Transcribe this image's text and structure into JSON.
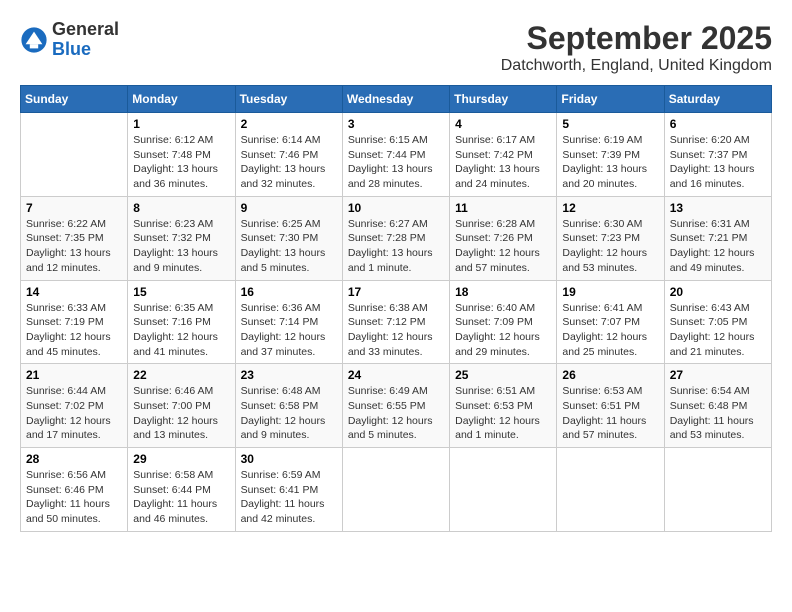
{
  "logo": {
    "general": "General",
    "blue": "Blue"
  },
  "title": "September 2025",
  "location": "Datchworth, England, United Kingdom",
  "headers": [
    "Sunday",
    "Monday",
    "Tuesday",
    "Wednesday",
    "Thursday",
    "Friday",
    "Saturday"
  ],
  "weeks": [
    [
      {
        "day": "",
        "info": ""
      },
      {
        "day": "1",
        "info": "Sunrise: 6:12 AM\nSunset: 7:48 PM\nDaylight: 13 hours\nand 36 minutes."
      },
      {
        "day": "2",
        "info": "Sunrise: 6:14 AM\nSunset: 7:46 PM\nDaylight: 13 hours\nand 32 minutes."
      },
      {
        "day": "3",
        "info": "Sunrise: 6:15 AM\nSunset: 7:44 PM\nDaylight: 13 hours\nand 28 minutes."
      },
      {
        "day": "4",
        "info": "Sunrise: 6:17 AM\nSunset: 7:42 PM\nDaylight: 13 hours\nand 24 minutes."
      },
      {
        "day": "5",
        "info": "Sunrise: 6:19 AM\nSunset: 7:39 PM\nDaylight: 13 hours\nand 20 minutes."
      },
      {
        "day": "6",
        "info": "Sunrise: 6:20 AM\nSunset: 7:37 PM\nDaylight: 13 hours\nand 16 minutes."
      }
    ],
    [
      {
        "day": "7",
        "info": "Sunrise: 6:22 AM\nSunset: 7:35 PM\nDaylight: 13 hours\nand 12 minutes."
      },
      {
        "day": "8",
        "info": "Sunrise: 6:23 AM\nSunset: 7:32 PM\nDaylight: 13 hours\nand 9 minutes."
      },
      {
        "day": "9",
        "info": "Sunrise: 6:25 AM\nSunset: 7:30 PM\nDaylight: 13 hours\nand 5 minutes."
      },
      {
        "day": "10",
        "info": "Sunrise: 6:27 AM\nSunset: 7:28 PM\nDaylight: 13 hours\nand 1 minute."
      },
      {
        "day": "11",
        "info": "Sunrise: 6:28 AM\nSunset: 7:26 PM\nDaylight: 12 hours\nand 57 minutes."
      },
      {
        "day": "12",
        "info": "Sunrise: 6:30 AM\nSunset: 7:23 PM\nDaylight: 12 hours\nand 53 minutes."
      },
      {
        "day": "13",
        "info": "Sunrise: 6:31 AM\nSunset: 7:21 PM\nDaylight: 12 hours\nand 49 minutes."
      }
    ],
    [
      {
        "day": "14",
        "info": "Sunrise: 6:33 AM\nSunset: 7:19 PM\nDaylight: 12 hours\nand 45 minutes."
      },
      {
        "day": "15",
        "info": "Sunrise: 6:35 AM\nSunset: 7:16 PM\nDaylight: 12 hours\nand 41 minutes."
      },
      {
        "day": "16",
        "info": "Sunrise: 6:36 AM\nSunset: 7:14 PM\nDaylight: 12 hours\nand 37 minutes."
      },
      {
        "day": "17",
        "info": "Sunrise: 6:38 AM\nSunset: 7:12 PM\nDaylight: 12 hours\nand 33 minutes."
      },
      {
        "day": "18",
        "info": "Sunrise: 6:40 AM\nSunset: 7:09 PM\nDaylight: 12 hours\nand 29 minutes."
      },
      {
        "day": "19",
        "info": "Sunrise: 6:41 AM\nSunset: 7:07 PM\nDaylight: 12 hours\nand 25 minutes."
      },
      {
        "day": "20",
        "info": "Sunrise: 6:43 AM\nSunset: 7:05 PM\nDaylight: 12 hours\nand 21 minutes."
      }
    ],
    [
      {
        "day": "21",
        "info": "Sunrise: 6:44 AM\nSunset: 7:02 PM\nDaylight: 12 hours\nand 17 minutes."
      },
      {
        "day": "22",
        "info": "Sunrise: 6:46 AM\nSunset: 7:00 PM\nDaylight: 12 hours\nand 13 minutes."
      },
      {
        "day": "23",
        "info": "Sunrise: 6:48 AM\nSunset: 6:58 PM\nDaylight: 12 hours\nand 9 minutes."
      },
      {
        "day": "24",
        "info": "Sunrise: 6:49 AM\nSunset: 6:55 PM\nDaylight: 12 hours\nand 5 minutes."
      },
      {
        "day": "25",
        "info": "Sunrise: 6:51 AM\nSunset: 6:53 PM\nDaylight: 12 hours\nand 1 minute."
      },
      {
        "day": "26",
        "info": "Sunrise: 6:53 AM\nSunset: 6:51 PM\nDaylight: 11 hours\nand 57 minutes."
      },
      {
        "day": "27",
        "info": "Sunrise: 6:54 AM\nSunset: 6:48 PM\nDaylight: 11 hours\nand 53 minutes."
      }
    ],
    [
      {
        "day": "28",
        "info": "Sunrise: 6:56 AM\nSunset: 6:46 PM\nDaylight: 11 hours\nand 50 minutes."
      },
      {
        "day": "29",
        "info": "Sunrise: 6:58 AM\nSunset: 6:44 PM\nDaylight: 11 hours\nand 46 minutes."
      },
      {
        "day": "30",
        "info": "Sunrise: 6:59 AM\nSunset: 6:41 PM\nDaylight: 11 hours\nand 42 minutes."
      },
      {
        "day": "",
        "info": ""
      },
      {
        "day": "",
        "info": ""
      },
      {
        "day": "",
        "info": ""
      },
      {
        "day": "",
        "info": ""
      }
    ]
  ]
}
